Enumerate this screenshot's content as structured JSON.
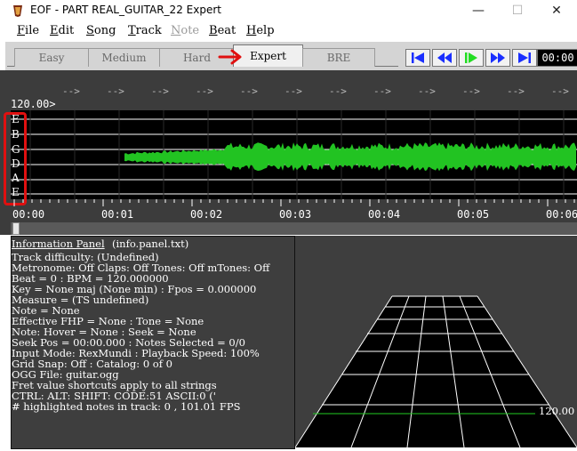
{
  "window": {
    "title": "EOF - PART REAL_GUITAR_22   Expert",
    "minimize_glyph": "—",
    "maximize_glyph": "☐",
    "close_glyph": "✕",
    "icon": "eof-app-icon"
  },
  "menu": [
    "File",
    "Edit",
    "Song",
    "Track",
    "Note",
    "Beat",
    "Help"
  ],
  "menu_disabled": [
    "Note"
  ],
  "tabs": [
    {
      "label": "Easy",
      "active": false
    },
    {
      "label": "Medium",
      "active": false
    },
    {
      "label": "Hard",
      "active": false
    },
    {
      "label": "Expert",
      "active": true
    },
    {
      "label": "BRE",
      "active": false
    }
  ],
  "transport": [
    {
      "name": "seek-start-button",
      "icon": "skip-to-start-icon"
    },
    {
      "name": "rewind-button",
      "icon": "rewind-icon"
    },
    {
      "name": "play-button",
      "icon": "play-icon"
    },
    {
      "name": "fast-forward-button",
      "icon": "fast-forward-icon"
    },
    {
      "name": "seek-end-button",
      "icon": "skip-to-end-icon"
    }
  ],
  "time_display": "00:00",
  "editor": {
    "bpm_label": "120.00>",
    "beat_marker_text": "-->",
    "strings": [
      "E",
      "B",
      "G",
      "D",
      "A",
      "E"
    ],
    "time_labels": [
      "00:00",
      "00:01",
      "00:02",
      "00:03",
      "00:04",
      "00:05",
      "00:06"
    ]
  },
  "info_panel": {
    "title": "Information Panel",
    "file": "(info.panel.txt)",
    "lines": [
      "Track difficulty: (Undefined)",
      "Metronome: Off Claps: Off Tones: Off mTones: Off",
      "Beat = 0 : BPM = 120.000000",
      "Key = None maj (None min) : Fpos = 0.000000",
      "Measure = (TS undefined)",
      "Note = None",
      "Effective FHP = None : Tone = None",
      "Note: Hover = None : Seek = None",
      "Seek Pos = 00:00.000 : Notes Selected = 0/0",
      "Input Mode: RexMundi : Playback Speed: 100%",
      "Grid Snap: Off : Catalog: 0 of 0",
      "OGG File: guitar.ogg",
      "Fret value shortcuts apply to all strings",
      "CTRL:   ALT:   SHIFT:   CODE:51 ASCII:0 ('",
      "# highlighted notes in track: 0 , 101.01 FPS"
    ]
  },
  "fretboard": {
    "bpm_label": "120.00"
  },
  "colors": {
    "waveform": "#22c322",
    "annotation_red": "#e01010",
    "transport_blue": "#1a2fff",
    "play_green": "#22dd22"
  }
}
